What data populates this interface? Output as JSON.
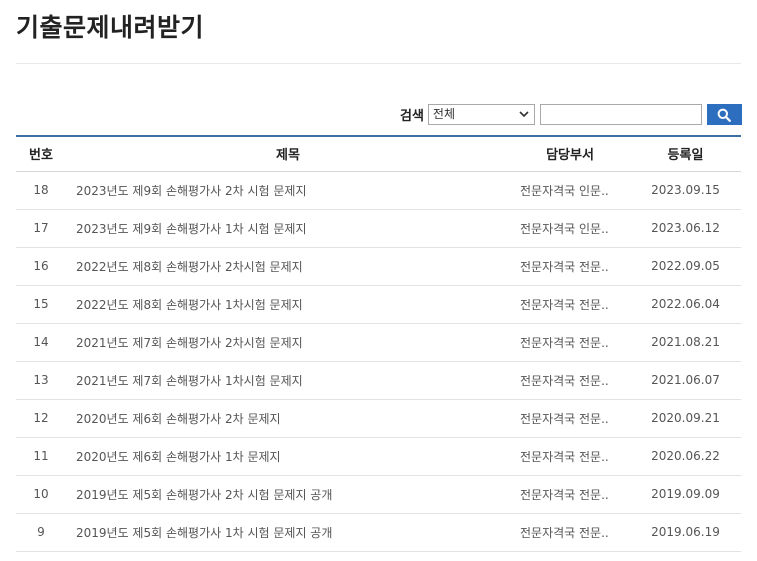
{
  "page": {
    "title": "기출문제내려받기"
  },
  "search": {
    "label": "검색",
    "select_value": "전체",
    "input_value": "",
    "button": "search"
  },
  "table": {
    "headers": {
      "no": "번호",
      "title": "제목",
      "dept": "담당부서",
      "date": "등록일"
    },
    "rows": [
      {
        "no": "18",
        "title": "2023년도 제9회 손해평가사 2차 시험 문제지",
        "dept": "전문자격국 인문..",
        "date": "2023.09.15"
      },
      {
        "no": "17",
        "title": "2023년도 제9회 손해평가사 1차 시험 문제지",
        "dept": "전문자격국 인문..",
        "date": "2023.06.12"
      },
      {
        "no": "16",
        "title": "2022년도 제8회 손해평가사 2차시험 문제지",
        "dept": "전문자격국 전문..",
        "date": "2022.09.05"
      },
      {
        "no": "15",
        "title": "2022년도 제8회 손해평가사 1차시험 문제지",
        "dept": "전문자격국 전문..",
        "date": "2022.06.04"
      },
      {
        "no": "14",
        "title": "2021년도 제7회 손해평가사 2차시험 문제지",
        "dept": "전문자격국 전문..",
        "date": "2021.08.21"
      },
      {
        "no": "13",
        "title": "2021년도 제7회 손해평가사 1차시험 문제지",
        "dept": "전문자격국 전문..",
        "date": "2021.06.07"
      },
      {
        "no": "12",
        "title": "2020년도 제6회 손해평가사 2차 문제지",
        "dept": "전문자격국 전문..",
        "date": "2020.09.21"
      },
      {
        "no": "11",
        "title": "2020년도 제6회 손해평가사 1차 문제지",
        "dept": "전문자격국 전문..",
        "date": "2020.06.22"
      },
      {
        "no": "10",
        "title": "2019년도 제5회 손해평가사 2차 시험 문제지 공개",
        "dept": "전문자격국 전문..",
        "date": "2019.09.09"
      },
      {
        "no": "9",
        "title": "2019년도 제5회 손해평가사 1차 시험 문제지 공개",
        "dept": "전문자격국 전문..",
        "date": "2019.06.19"
      }
    ]
  }
}
